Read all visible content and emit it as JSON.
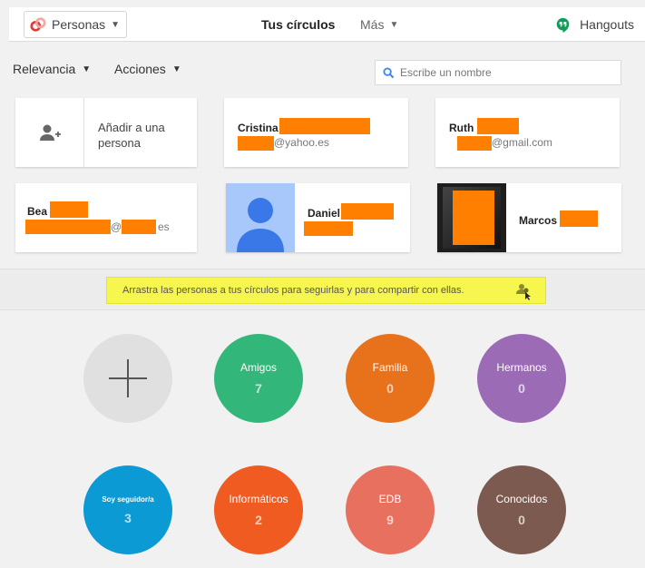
{
  "topbar": {
    "app_name": "Personas",
    "tabs": [
      {
        "label": "Tus círculos",
        "active": true
      },
      {
        "label": "Más",
        "active": false
      }
    ],
    "hangouts_label": "Hangouts"
  },
  "filters": {
    "sort_label": "Relevancia",
    "actions_label": "Acciones"
  },
  "search": {
    "placeholder": "Escribe un nombre"
  },
  "add_person_card": {
    "label": "Añadir a una persona"
  },
  "contacts": [
    {
      "name": "Cristina",
      "email": "@yahoo.es"
    },
    {
      "name": "Ruth",
      "email": "@gmail.com"
    },
    {
      "name": "Bea",
      "email_start": "@",
      "email_end": "es"
    },
    {
      "name": "Daniel"
    },
    {
      "name": "Marcos"
    }
  ],
  "hint": {
    "text": "Arrastra las personas a tus círculos para seguirlas y para compartir con ellas."
  },
  "circles": [
    {
      "name": "Amigos",
      "count": "7",
      "color": "#33b679"
    },
    {
      "name": "Familia",
      "count": "0",
      "color": "#e8711c"
    },
    {
      "name": "Hermanos",
      "count": "0",
      "color": "#9b6bb5"
    },
    {
      "name": "Soy seguidor/a",
      "count": "3",
      "color": "#0b9ad3"
    },
    {
      "name": "Informáticos",
      "count": "2",
      "color": "#f05b22"
    },
    {
      "name": "EDB",
      "count": "9",
      "color": "#e8705e"
    },
    {
      "name": "Conocidos",
      "count": "0",
      "color": "#7d5a4f"
    }
  ],
  "colors": {
    "redaction": "#ff7f00",
    "accent_blue": "#4285f4",
    "hint_yellow": "#f6f64e"
  },
  "icons": [
    "personas-logo-icon",
    "chevron-down-icon",
    "hangouts-icon",
    "search-icon",
    "add-person-icon",
    "avatar-placeholder-icon",
    "drag-people-icon",
    "plus-icon"
  ]
}
